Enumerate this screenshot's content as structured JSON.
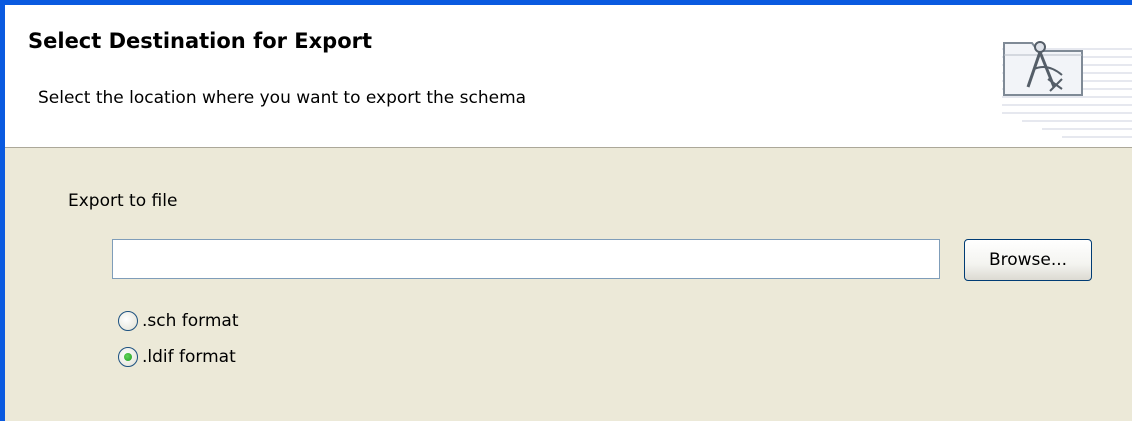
{
  "banner": {
    "title": "Select Destination for Export",
    "description": "Select the location where you want to export the schema",
    "icon": "export-wizard-compass-icon"
  },
  "export": {
    "label": "Export to file",
    "file_path_value": "",
    "browse_label": "Browse..."
  },
  "format": {
    "options": [
      {
        "label": ".sch format",
        "selected": false
      },
      {
        "label": ".ldif format",
        "selected": true
      }
    ]
  },
  "colors": {
    "window_border": "#0a5ae0",
    "dialog_background": "#ece9d8",
    "banner_background": "#ffffff",
    "radio_selected": "#21a121"
  }
}
